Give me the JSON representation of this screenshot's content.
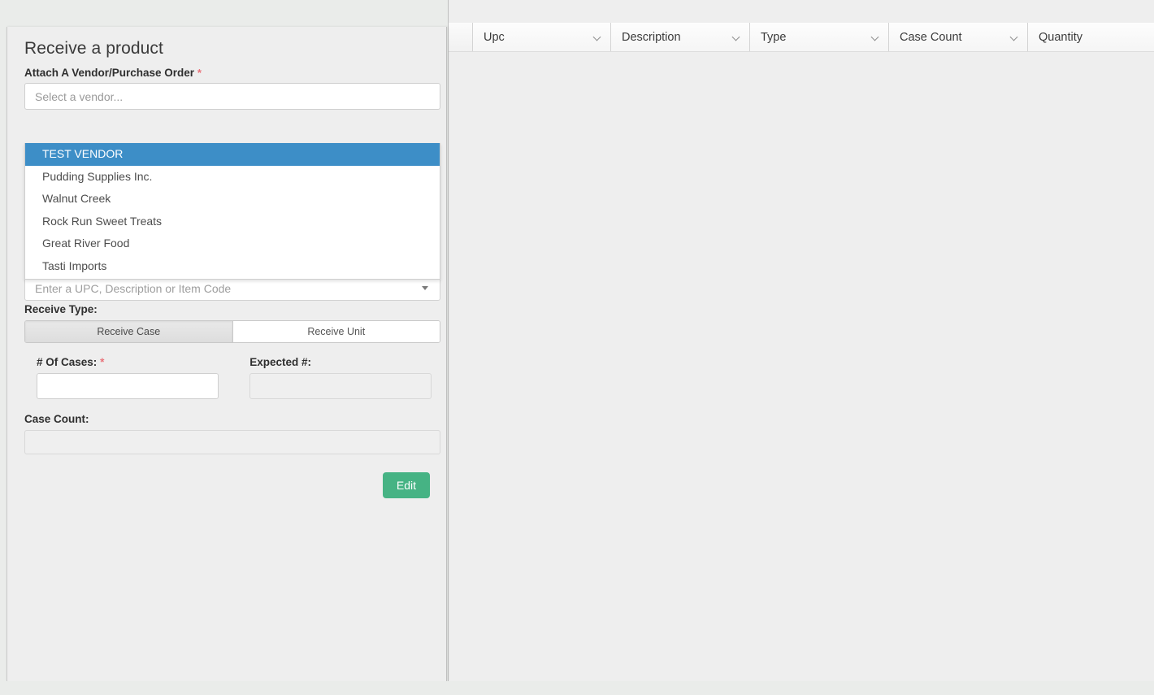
{
  "form": {
    "title": "Receive a product",
    "vendor_field": {
      "label": "Attach A Vendor/Purchase Order",
      "required_marker": "*",
      "placeholder": "Select a vendor...",
      "value": "",
      "options": [
        "TEST VENDOR",
        "Pudding Supplies Inc.",
        "Walnut Creek",
        "Rock Run Sweet Treats",
        "Great River Food",
        "Tasti Imports"
      ],
      "highlighted_option": "TEST VENDOR"
    },
    "upc_field": {
      "placeholder": "Enter a UPC, Description or Item Code",
      "value": "",
      "caret_icon": "caret-down-icon"
    },
    "receive_type": {
      "label": "Receive Type:",
      "options": [
        "Receive Case",
        "Receive Unit"
      ],
      "selected": "Receive Case"
    },
    "cases_field": {
      "label": "# Of Cases:",
      "required_marker": "*",
      "value": ""
    },
    "expected_field": {
      "label": "Expected #:",
      "value": "",
      "disabled": true
    },
    "case_count_field": {
      "label": "Case Count:",
      "value": "",
      "disabled": true
    },
    "submit_button": {
      "label": "Edit"
    }
  },
  "grid": {
    "spacer_column": "",
    "columns": [
      {
        "label": "Upc",
        "menu_icon": "chevron-down-icon"
      },
      {
        "label": "Description",
        "menu_icon": "chevron-down-icon"
      },
      {
        "label": "Type",
        "menu_icon": "chevron-down-icon"
      },
      {
        "label": "Case Count",
        "menu_icon": "chevron-down-icon"
      },
      {
        "label": "Quantity",
        "menu_icon": ""
      }
    ],
    "rows": []
  },
  "colors": {
    "page_background": "#eaecea",
    "panel_background": "#eeeeee",
    "dropdown_highlight": "#3d8ec7",
    "required_marker": "#e9737a",
    "primary_button": "#46b384",
    "grid_header": "#f6f6f6"
  }
}
